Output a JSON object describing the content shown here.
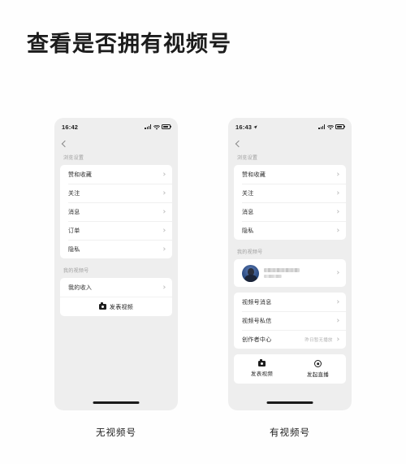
{
  "page": {
    "title": "查看是否拥有视频号",
    "background_color": "#fefefe"
  },
  "phones": [
    {
      "caption": "无视频号",
      "status_bar": {
        "time": "16:42",
        "location_icon": false,
        "signal_icon": "signal-bars-icon",
        "wifi_icon": "wifi-icon",
        "battery_icon": "battery-icon"
      },
      "nav": {
        "back_icon": "chevron-left-icon"
      },
      "sections": [
        {
          "label": "浏览设置",
          "rows": [
            {
              "label": "赞和收藏",
              "hint": ""
            },
            {
              "label": "关注",
              "hint": ""
            },
            {
              "label": "消息",
              "hint": ""
            },
            {
              "label": "订单",
              "hint": ""
            },
            {
              "label": "隐私",
              "hint": ""
            }
          ]
        },
        {
          "label": "我的视频号",
          "rows": [
            {
              "label": "我的收入",
              "hint": ""
            }
          ]
        }
      ],
      "publish_button": {
        "label": "发表视频",
        "icon": "camera-icon"
      }
    },
    {
      "caption": "有视频号",
      "status_bar": {
        "time": "16:43",
        "location_icon": true,
        "signal_icon": "signal-bars-icon",
        "wifi_icon": "wifi-icon",
        "battery_icon": "battery-icon"
      },
      "nav": {
        "back_icon": "chevron-left-icon"
      },
      "sections": [
        {
          "label": "浏览设置",
          "rows": [
            {
              "label": "赞和收藏",
              "hint": ""
            },
            {
              "label": "关注",
              "hint": ""
            },
            {
              "label": "消息",
              "hint": ""
            },
            {
              "label": "隐私",
              "hint": ""
            }
          ]
        },
        {
          "label": "我的视频号",
          "profile": {
            "avatar_icon": "user-avatar",
            "name_redacted": true,
            "subtitle_redacted": true
          },
          "rows": [
            {
              "label": "视频号消息",
              "hint": ""
            },
            {
              "label": "视频号私信",
              "hint": ""
            },
            {
              "label": "创作者中心",
              "hint": "昨日暂无播放"
            }
          ]
        }
      ],
      "actions": [
        {
          "label": "发表视频",
          "icon": "camera-icon"
        },
        {
          "label": "发起直播",
          "icon": "live-record-icon"
        }
      ]
    }
  ]
}
